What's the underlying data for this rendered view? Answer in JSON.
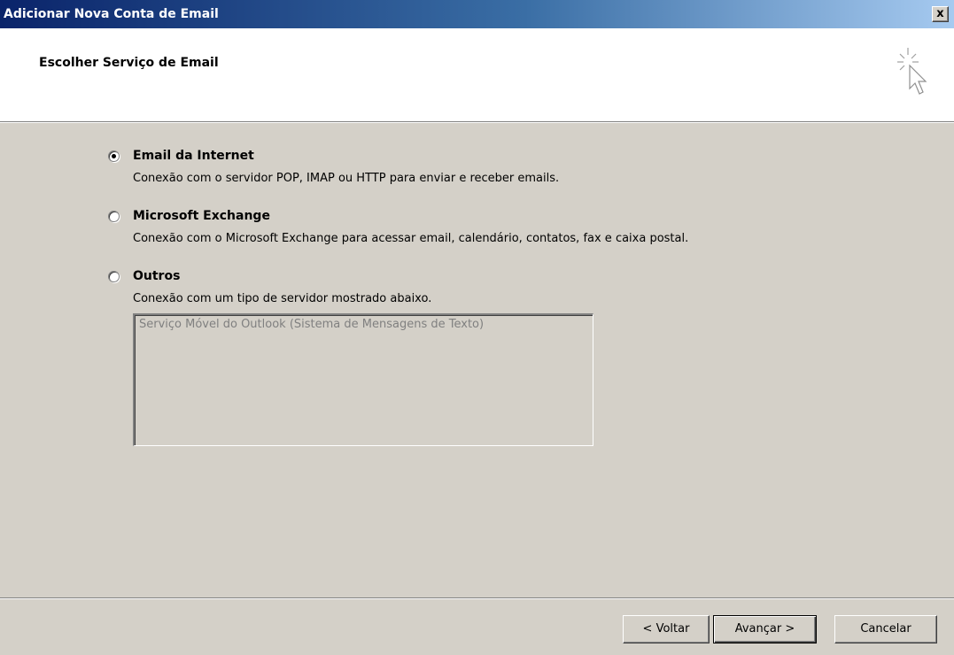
{
  "window": {
    "title": "Adicionar Nova Conta de Email",
    "close_label": "x"
  },
  "header": {
    "title": "Escolher Serviço de Email",
    "icon": "wizard-cursor-sparkle-icon"
  },
  "options": [
    {
      "label": "Email da Internet",
      "description": "Conexão com o servidor POP, IMAP ou HTTP para enviar e receber emails.",
      "selected": true
    },
    {
      "label": "Microsoft Exchange",
      "description": "Conexão com o Microsoft Exchange para acessar email, calendário, contatos, fax e caixa postal.",
      "selected": false
    },
    {
      "label": "Outros",
      "description": "Conexão com um tipo de servidor mostrado abaixo.",
      "selected": false
    }
  ],
  "other_services": {
    "items": [
      "Serviço Móvel do Outlook (Sistema de Mensagens de Texto)"
    ],
    "enabled": false
  },
  "buttons": {
    "back": "< Voltar",
    "next": "Avançar >",
    "cancel": "Cancelar"
  },
  "colors": {
    "titlebar_start": "#0a246a",
    "titlebar_end": "#a6caf0",
    "dialog_bg": "#d4d0c8",
    "disabled_text": "#808080"
  }
}
